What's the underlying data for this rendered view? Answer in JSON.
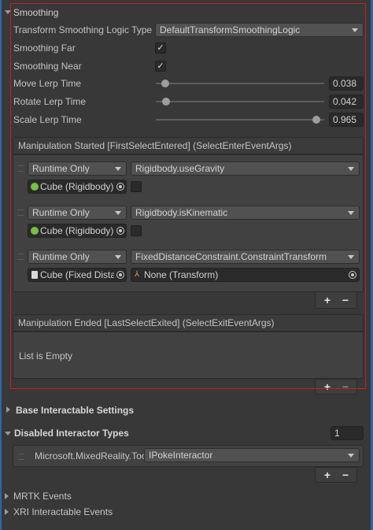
{
  "colors": {
    "accent_red": "#c81e1e",
    "selection_blue": "#2f65a8",
    "cube_green": "#76c043"
  },
  "smoothing": {
    "title": "Smoothing",
    "transform_logic_label": "Transform Smoothing Logic Type",
    "transform_logic_value": "DefaultTransformSmoothingLogic",
    "smoothing_far_label": "Smoothing Far",
    "smoothing_far_checked": true,
    "smoothing_near_label": "Smoothing Near",
    "smoothing_near_checked": true,
    "checkmark": "✓",
    "move_lerp_label": "Move Lerp Time",
    "move_lerp_value": "0.038",
    "rotate_lerp_label": "Rotate Lerp Time",
    "rotate_lerp_value": "0.042",
    "scale_lerp_label": "Scale Lerp Time",
    "scale_lerp_value": "0.965"
  },
  "manipulation_started": {
    "header": "Manipulation Started [FirstSelectEntered] (SelectEnterEventArgs)",
    "listeners": [
      {
        "mode": "Runtime Only",
        "function": "Rigidbody.useGravity",
        "object": "Cube (Rigidbody)",
        "object_icon": "rigidbody-icon",
        "arg_type": "checkbox"
      },
      {
        "mode": "Runtime Only",
        "function": "Rigidbody.isKinematic",
        "object": "Cube (Rigidbody)",
        "object_icon": "rigidbody-icon",
        "arg_type": "checkbox"
      },
      {
        "mode": "Runtime Only",
        "function": "FixedDistanceConstraint.ConstraintTransform",
        "object": "Cube (Fixed Distar",
        "object_icon": "script-icon",
        "arg_type": "object",
        "arg_value": "None (Transform)"
      }
    ],
    "add": "+",
    "remove": "−"
  },
  "manipulation_ended": {
    "header": "Manipulation Ended [LastSelectExited] (SelectExitEventArgs)",
    "empty_text": "List is Empty",
    "add": "+",
    "remove": "−"
  },
  "base_interactable": {
    "title": "Base Interactable Settings"
  },
  "disabled_interactor_types": {
    "title": "Disabled Interactor Types",
    "count": "1",
    "item_label": "Microsoft.MixedReality.Toolk",
    "item_value": "IPokeInteractor",
    "add": "+",
    "remove": "−"
  },
  "mrtk_events": {
    "title": "MRTK Events"
  },
  "xri_events": {
    "title": "XRI Interactable Events"
  }
}
